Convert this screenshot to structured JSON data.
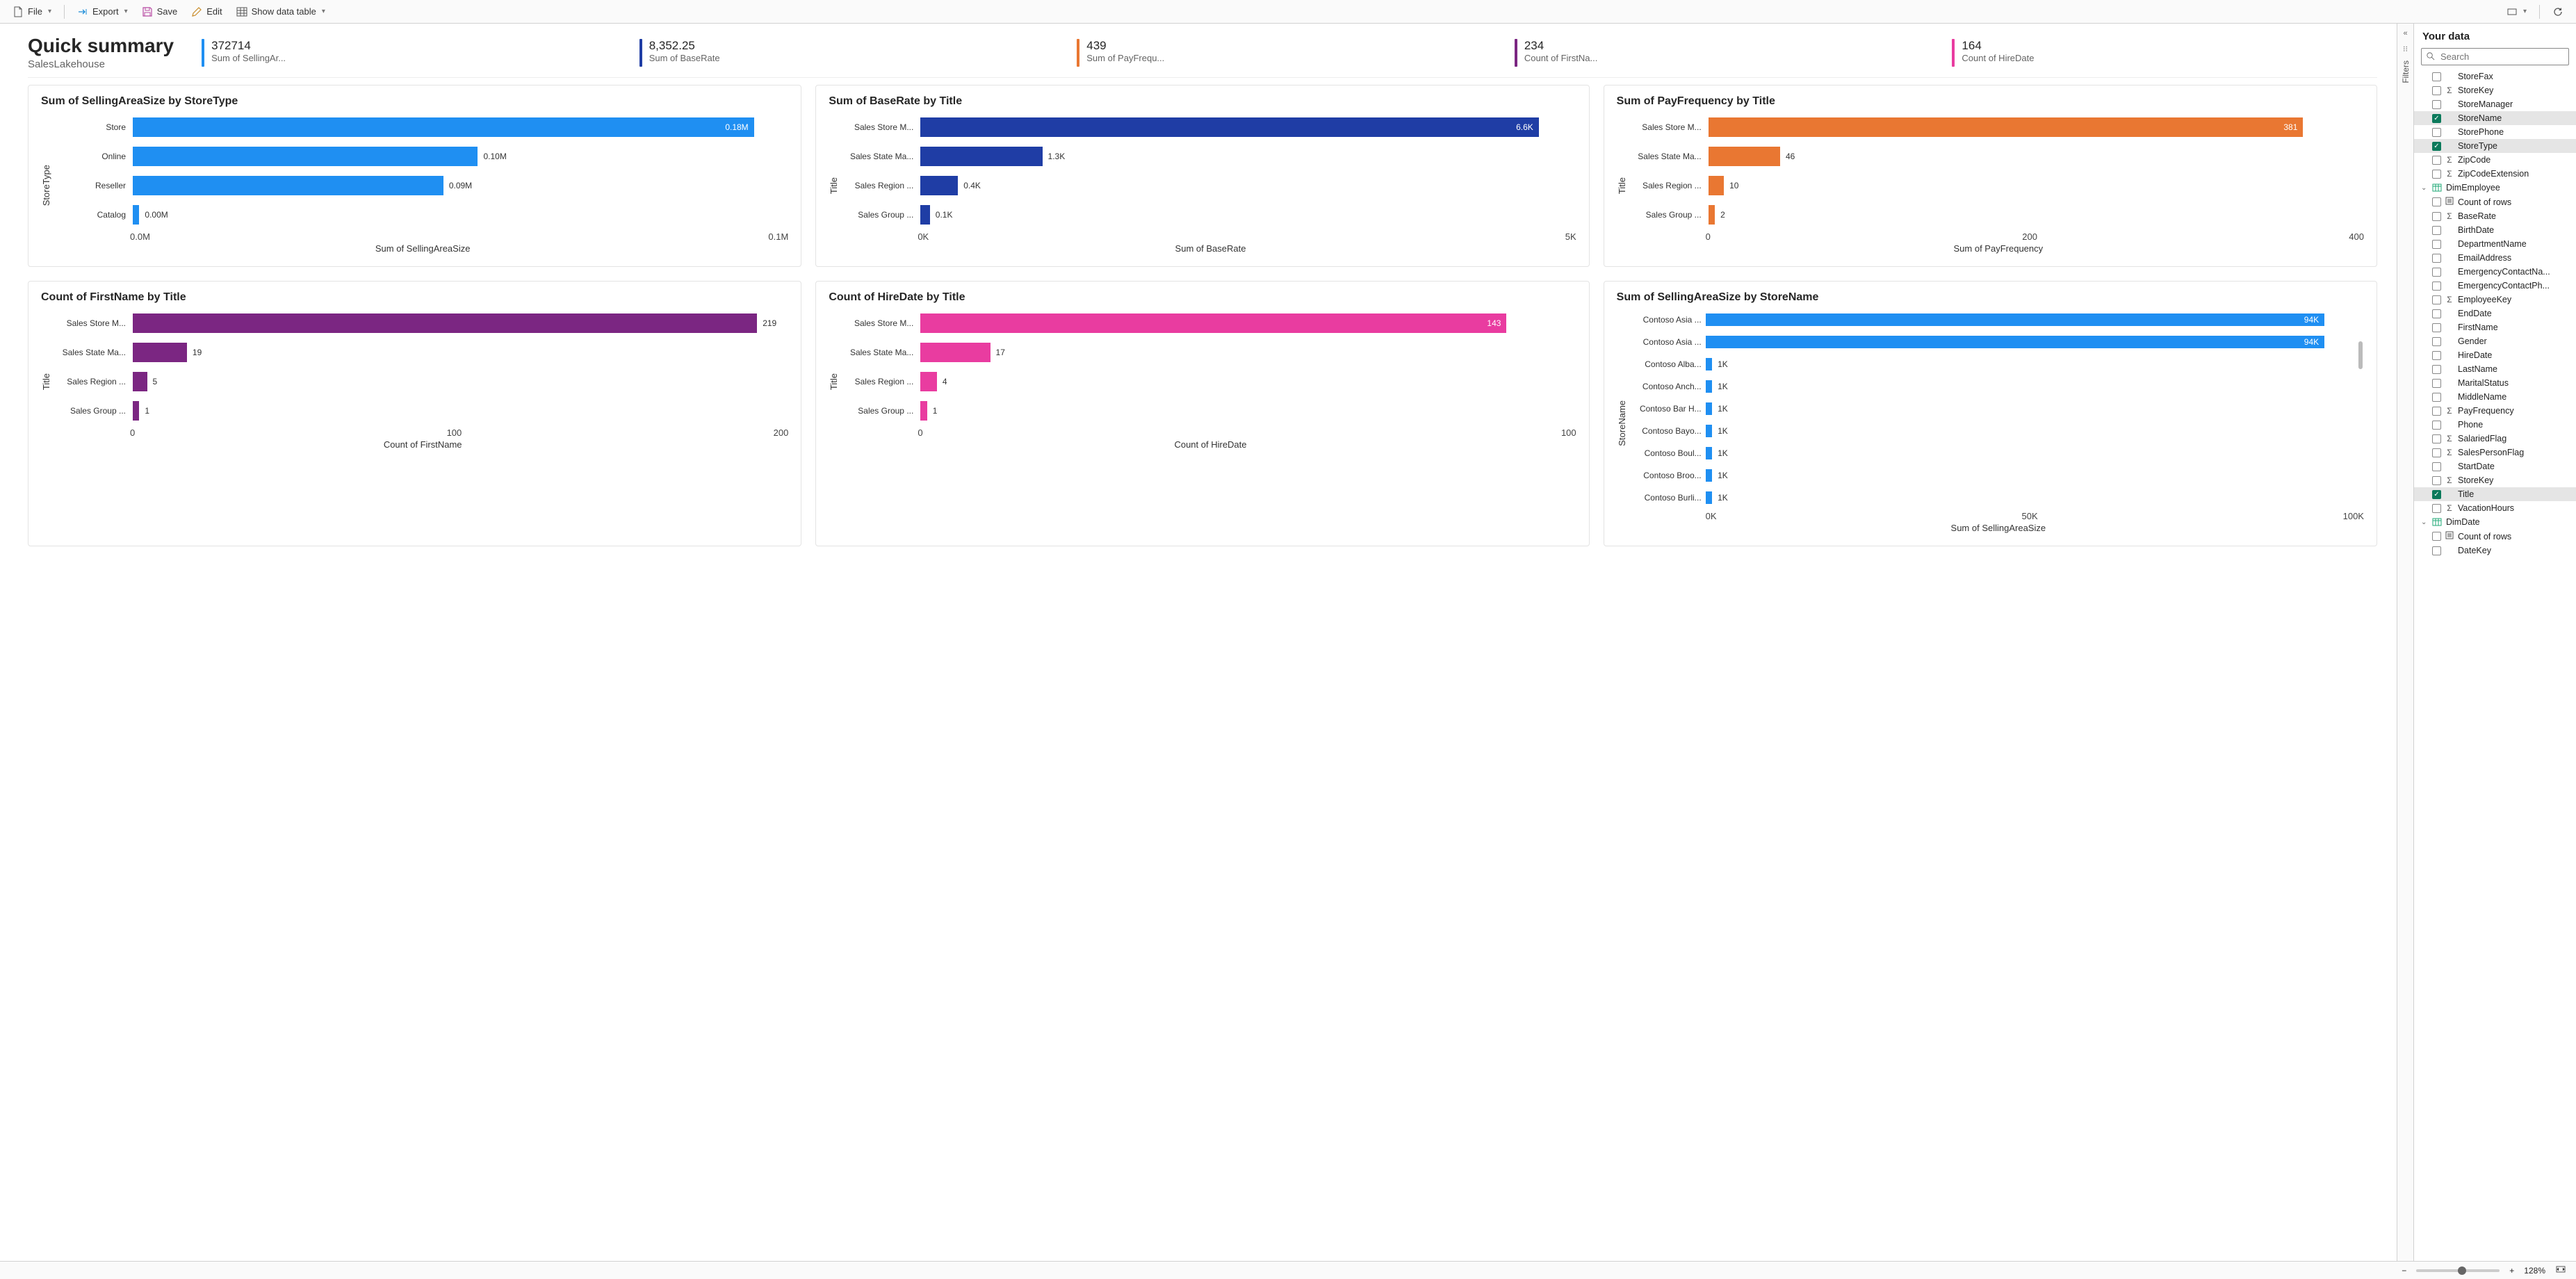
{
  "toolbar": {
    "file": "File",
    "export": "Export",
    "save": "Save",
    "edit": "Edit",
    "show_table": "Show data table"
  },
  "header": {
    "title": "Quick summary",
    "subtitle": "SalesLakehouse"
  },
  "kpis": [
    {
      "value": "372714",
      "label": "Sum of SellingAr...",
      "color": "#1f8ff2"
    },
    {
      "value": "8,352.25",
      "label": "Sum of BaseRate",
      "color": "#1f3da5"
    },
    {
      "value": "439",
      "label": "Sum of PayFrequ...",
      "color": "#e97732"
    },
    {
      "value": "234",
      "label": "Count of FirstNa...",
      "color": "#7b2682"
    },
    {
      "value": "164",
      "label": "Count of HireDate",
      "color": "#e93ca0"
    }
  ],
  "chart_data": [
    {
      "id": "c1",
      "type": "bar",
      "orientation": "horizontal",
      "title": "Sum of SellingAreaSize by StoreType",
      "ylabel": "StoreType",
      "xlabel": "Sum of SellingAreaSize",
      "xticks": [
        "0.0M",
        "0.1M"
      ],
      "color": "#1f8ff2",
      "categories": [
        "Store",
        "Online",
        "Reseller",
        "Catalog"
      ],
      "display": [
        "0.18M",
        "0.10M",
        "0.09M",
        "0.00M"
      ],
      "values": [
        180000,
        100000,
        90000,
        1000
      ],
      "max": 190000,
      "label_inside": [
        true,
        false,
        false,
        false
      ]
    },
    {
      "id": "c2",
      "type": "bar",
      "orientation": "horizontal",
      "title": "Sum of BaseRate by Title",
      "ylabel": "Title",
      "xlabel": "Sum of BaseRate",
      "xticks": [
        "0K",
        "5K"
      ],
      "color": "#1f3da5",
      "categories": [
        "Sales Store M...",
        "Sales State Ma...",
        "Sales Region ...",
        "Sales Group ..."
      ],
      "display": [
        "6.6K",
        "1.3K",
        "0.4K",
        "0.1K"
      ],
      "values": [
        6600,
        1300,
        400,
        100
      ],
      "max": 7000,
      "label_inside": [
        true,
        false,
        false,
        false
      ]
    },
    {
      "id": "c3",
      "type": "bar",
      "orientation": "horizontal",
      "title": "Sum of PayFrequency by Title",
      "ylabel": "Title",
      "xlabel": "Sum of PayFrequency",
      "xticks": [
        "0",
        "200",
        "400"
      ],
      "color": "#e97732",
      "categories": [
        "Sales Store M...",
        "Sales State Ma...",
        "Sales Region ...",
        "Sales Group ..."
      ],
      "display": [
        "381",
        "46",
        "10",
        "2"
      ],
      "values": [
        381,
        46,
        10,
        2
      ],
      "max": 420,
      "label_inside": [
        true,
        false,
        false,
        false
      ]
    },
    {
      "id": "c4",
      "type": "bar",
      "orientation": "horizontal",
      "title": "Count of FirstName by Title",
      "ylabel": "Title",
      "xlabel": "Count of FirstName",
      "xticks": [
        "0",
        "100",
        "200"
      ],
      "color": "#7b2682",
      "categories": [
        "Sales Store M...",
        "Sales State Ma...",
        "Sales Region ...",
        "Sales Group ..."
      ],
      "display": [
        "219",
        "19",
        "5",
        "1"
      ],
      "values": [
        219,
        19,
        5,
        1
      ],
      "max": 230,
      "label_inside": [
        false,
        false,
        false,
        false
      ]
    },
    {
      "id": "c5",
      "type": "bar",
      "orientation": "horizontal",
      "title": "Count of HireDate by Title",
      "ylabel": "Title",
      "xlabel": "Count of HireDate",
      "xticks": [
        "0",
        "100"
      ],
      "color": "#e93ca0",
      "categories": [
        "Sales Store M...",
        "Sales State Ma...",
        "Sales Region ...",
        "Sales Group ..."
      ],
      "display": [
        "143",
        "17",
        "4",
        "1"
      ],
      "values": [
        143,
        17,
        4,
        1
      ],
      "max": 160,
      "label_inside": [
        true,
        false,
        false,
        false
      ]
    },
    {
      "id": "c6",
      "type": "bar",
      "orientation": "horizontal",
      "title": "Sum of SellingAreaSize by StoreName",
      "ylabel": "StoreName",
      "xlabel": "Sum of SellingAreaSize",
      "xticks": [
        "0K",
        "50K",
        "100K"
      ],
      "color": "#1f8ff2",
      "compact": true,
      "scroll": true,
      "categories": [
        "Contoso Asia ...",
        "Contoso Asia ...",
        "Contoso Alba...",
        "Contoso Anch...",
        "Contoso Bar H...",
        "Contoso Bayo...",
        "Contoso Boul...",
        "Contoso Broo...",
        "Contoso Burli..."
      ],
      "display": [
        "94K",
        "94K",
        "1K",
        "1K",
        "1K",
        "1K",
        "1K",
        "1K",
        "1K"
      ],
      "values": [
        94000,
        94000,
        1000,
        1000,
        1000,
        1000,
        1000,
        1000,
        1000
      ],
      "max": 100000,
      "label_inside": [
        true,
        true,
        false,
        false,
        false,
        false,
        false,
        false,
        false
      ]
    }
  ],
  "rails": {
    "filters": "Filters"
  },
  "data_pane": {
    "title": "Your data",
    "search_placeholder": "Search",
    "fields": [
      {
        "type": "field",
        "name": "StoreFax",
        "sigma": false,
        "checked": false
      },
      {
        "type": "field",
        "name": "StoreKey",
        "sigma": true,
        "checked": false
      },
      {
        "type": "field",
        "name": "StoreManager",
        "sigma": false,
        "checked": false
      },
      {
        "type": "field",
        "name": "StoreName",
        "sigma": false,
        "checked": true,
        "selected": true
      },
      {
        "type": "field",
        "name": "StorePhone",
        "sigma": false,
        "checked": false
      },
      {
        "type": "field",
        "name": "StoreType",
        "sigma": false,
        "checked": true,
        "selected": true
      },
      {
        "type": "field",
        "name": "ZipCode",
        "sigma": true,
        "checked": false
      },
      {
        "type": "field",
        "name": "ZipCodeExtension",
        "sigma": true,
        "checked": false
      },
      {
        "type": "table",
        "name": "DimEmployee",
        "expanded": true,
        "badge": true
      },
      {
        "type": "field",
        "name": "Count of rows",
        "sigma": false,
        "icon": "calc",
        "checked": false
      },
      {
        "type": "field",
        "name": "BaseRate",
        "sigma": true,
        "checked": false
      },
      {
        "type": "field",
        "name": "BirthDate",
        "sigma": false,
        "checked": false
      },
      {
        "type": "field",
        "name": "DepartmentName",
        "sigma": false,
        "checked": false
      },
      {
        "type": "field",
        "name": "EmailAddress",
        "sigma": false,
        "checked": false
      },
      {
        "type": "field",
        "name": "EmergencyContactNa...",
        "sigma": false,
        "checked": false
      },
      {
        "type": "field",
        "name": "EmergencyContactPh...",
        "sigma": false,
        "checked": false
      },
      {
        "type": "field",
        "name": "EmployeeKey",
        "sigma": true,
        "checked": false
      },
      {
        "type": "field",
        "name": "EndDate",
        "sigma": false,
        "checked": false
      },
      {
        "type": "field",
        "name": "FirstName",
        "sigma": false,
        "checked": false
      },
      {
        "type": "field",
        "name": "Gender",
        "sigma": false,
        "checked": false
      },
      {
        "type": "field",
        "name": "HireDate",
        "sigma": false,
        "checked": false
      },
      {
        "type": "field",
        "name": "LastName",
        "sigma": false,
        "checked": false
      },
      {
        "type": "field",
        "name": "MaritalStatus",
        "sigma": false,
        "checked": false
      },
      {
        "type": "field",
        "name": "MiddleName",
        "sigma": false,
        "checked": false
      },
      {
        "type": "field",
        "name": "PayFrequency",
        "sigma": true,
        "checked": false
      },
      {
        "type": "field",
        "name": "Phone",
        "sigma": false,
        "checked": false
      },
      {
        "type": "field",
        "name": "SalariedFlag",
        "sigma": true,
        "checked": false
      },
      {
        "type": "field",
        "name": "SalesPersonFlag",
        "sigma": true,
        "checked": false
      },
      {
        "type": "field",
        "name": "StartDate",
        "sigma": false,
        "checked": false
      },
      {
        "type": "field",
        "name": "StoreKey",
        "sigma": true,
        "checked": false
      },
      {
        "type": "field",
        "name": "Title",
        "sigma": false,
        "checked": true,
        "selected": true
      },
      {
        "type": "field",
        "name": "VacationHours",
        "sigma": true,
        "checked": false
      },
      {
        "type": "table",
        "name": "DimDate",
        "expanded": true
      },
      {
        "type": "field",
        "name": "Count of rows",
        "sigma": false,
        "icon": "calc",
        "checked": false
      },
      {
        "type": "field",
        "name": "DateKey",
        "sigma": false,
        "checked": false
      }
    ]
  },
  "footer": {
    "zoom": "128%"
  }
}
